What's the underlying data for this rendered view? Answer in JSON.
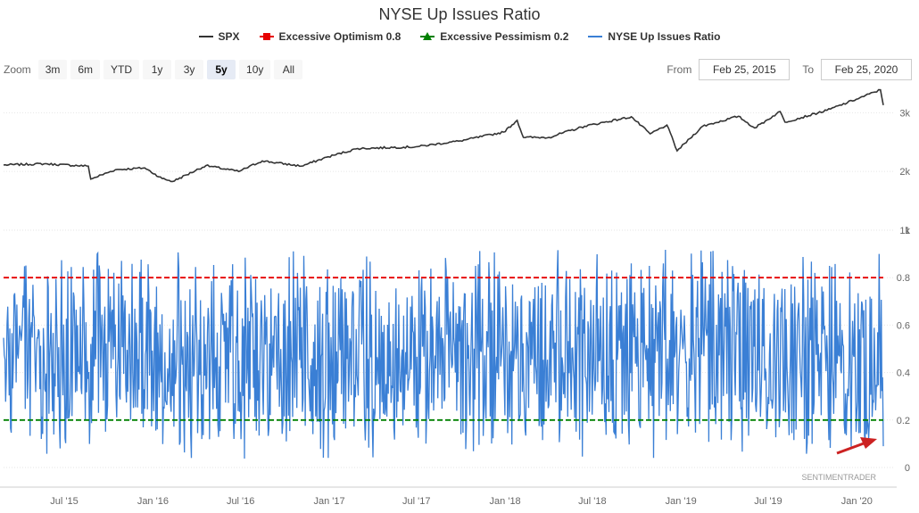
{
  "title": "NYSE Up Issues Ratio",
  "legend": [
    {
      "name": "SPX",
      "color": "#333333",
      "marker": "line"
    },
    {
      "name": "Excessive Optimism 0.8",
      "color": "#e60000",
      "marker": "square"
    },
    {
      "name": "Excessive Pessimism 0.2",
      "color": "#008000",
      "marker": "triangle"
    },
    {
      "name": "NYSE Up Issues Ratio",
      "color": "#3a7fd5",
      "marker": "line"
    }
  ],
  "zoom": {
    "label": "Zoom",
    "buttons": [
      "3m",
      "6m",
      "YTD",
      "1y",
      "3y",
      "5y",
      "10y",
      "All"
    ],
    "active": "5y"
  },
  "range": {
    "from_label": "From",
    "from_value": "Feb 25, 2015",
    "to_label": "To",
    "to_value": "Feb 25, 2020"
  },
  "credit": "SENTIMENTRADER",
  "chart_data": {
    "type": "line",
    "x_range": [
      "2015-02-25",
      "2020-02-25"
    ],
    "x_ticks": [
      "Jul '15",
      "Jan '16",
      "Jul '16",
      "Jan '17",
      "Jul '17",
      "Jan '18",
      "Jul '18",
      "Jan '19",
      "Jul '19",
      "Jan '20"
    ],
    "panes": [
      {
        "name": "SPX",
        "y_ticks": [
          "1k",
          "2k",
          "3k"
        ],
        "y_range": [
          1000,
          3400
        ],
        "series": [
          {
            "name": "SPX",
            "color": "#333333",
            "x": [
              "2015-02-25",
              "2015-05-20",
              "2015-08-20",
              "2015-08-25",
              "2015-10-15",
              "2015-12-15",
              "2016-01-20",
              "2016-02-11",
              "2016-04-20",
              "2016-06-27",
              "2016-08-15",
              "2016-11-04",
              "2016-12-30",
              "2017-03-01",
              "2017-06-30",
              "2017-09-30",
              "2017-12-29",
              "2018-01-26",
              "2018-02-08",
              "2018-04-02",
              "2018-06-15",
              "2018-09-20",
              "2018-10-29",
              "2018-12-03",
              "2018-12-24",
              "2019-02-15",
              "2019-04-30",
              "2019-06-03",
              "2019-07-26",
              "2019-08-05",
              "2019-10-31",
              "2019-12-31",
              "2020-02-19",
              "2020-02-25"
            ],
            "values": [
              2110,
              2130,
              2090,
              1870,
              2030,
              2060,
              1880,
              1830,
              2100,
              2000,
              2180,
              2090,
              2250,
              2390,
              2420,
              2520,
              2670,
              2870,
              2580,
              2580,
              2770,
              2930,
              2640,
              2790,
              2350,
              2770,
              2940,
              2740,
              3020,
              2840,
              3040,
              3230,
              3390,
              3130
            ]
          }
        ]
      },
      {
        "name": "NYSE Up Issues Ratio",
        "y_ticks": [
          "0",
          "0.2",
          "0.4",
          "0.6",
          "0.8",
          "1"
        ],
        "y_range": [
          0,
          1
        ],
        "series": [
          {
            "name": "NYSE Up Issues Ratio",
            "color": "#3a7fd5",
            "min": 0.03,
            "max": 0.92,
            "typical_range": [
              0.2,
              0.75
            ],
            "last_value": 0.09
          },
          {
            "name": "Excessive Optimism 0.8",
            "color": "#e60000",
            "constant": 0.8
          },
          {
            "name": "Excessive Pessimism 0.2",
            "color": "#008000",
            "constant": 0.2
          }
        ]
      }
    ],
    "annotations": [
      {
        "type": "arrow",
        "color": "#cc2222",
        "points_to": "2020-02-25"
      }
    ],
    "grid": true,
    "legend_position": "top"
  }
}
